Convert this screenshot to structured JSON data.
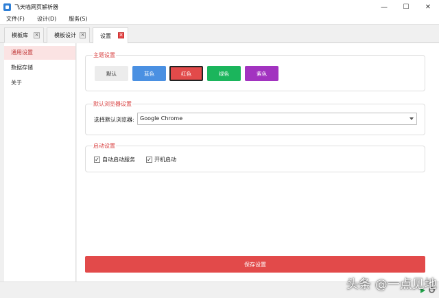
{
  "window": {
    "title": "飞天喵网页解析器",
    "minimize": "—",
    "maximize": "☐",
    "close": "✕"
  },
  "menu": {
    "items": [
      "文件(F)",
      "设计(D)",
      "服务(S)"
    ]
  },
  "tabs": [
    {
      "label": "模板库",
      "close": "✕"
    },
    {
      "label": "模板设计",
      "close": "✕"
    },
    {
      "label": "设置",
      "close": "✕"
    }
  ],
  "sidebar": {
    "items": [
      "通用设置",
      "数据存储",
      "关于"
    ]
  },
  "theme": {
    "title": "主题设置",
    "buttons": [
      {
        "label": "默认",
        "color": "#ececec"
      },
      {
        "label": "蓝色",
        "color": "#4a90e2"
      },
      {
        "label": "红色",
        "color": "#e24a4a"
      },
      {
        "label": "绿色",
        "color": "#1bb55c"
      },
      {
        "label": "紫色",
        "color": "#a233c0"
      }
    ]
  },
  "browser": {
    "title": "默认浏览器设置",
    "label": "选择默认浏览器:",
    "selected": "Google Chrome"
  },
  "startup": {
    "title": "启动设置",
    "options": [
      {
        "label": "自动启动服务",
        "checked": "✓"
      },
      {
        "label": "开机启动",
        "checked": "✓"
      }
    ]
  },
  "save_label": "保存设置",
  "watermark": "头条 @一点见地"
}
